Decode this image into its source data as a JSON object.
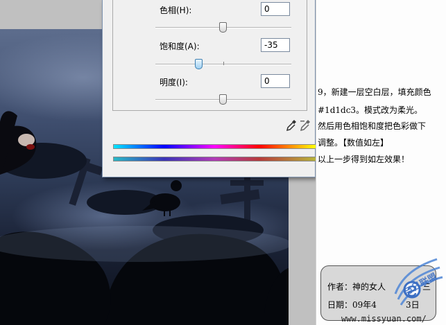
{
  "dialog": {
    "hue": {
      "label": "色相(H):",
      "value": "0",
      "slider_fraction": 0.5
    },
    "saturation": {
      "label": "饱和度(A):",
      "value": "-35",
      "slider_fraction": 0.325
    },
    "lightness": {
      "label": "明度(I):",
      "value": "0",
      "slider_fraction": 0.5
    }
  },
  "tutorial": {
    "lines": [
      "9，新建一层空白层，填充颜色",
      "#1d1dc3。模式改为柔光。",
      "然后用色相饱和度把色彩做下",
      "调整。【数值如左】",
      "以上一步得到如左效果！"
    ]
  },
  "credit": {
    "author": "作者：神的女人",
    "author_tail": "三",
    "date": "日期：09年4",
    "date_tail": "3日",
    "site": "www.missyuan.com/"
  },
  "watermark": {
    "text": "与日联盟"
  },
  "icons": {
    "eyedropper": "eyedropper-icon",
    "eyedropper_minus": "eyedropper-minus-icon"
  }
}
